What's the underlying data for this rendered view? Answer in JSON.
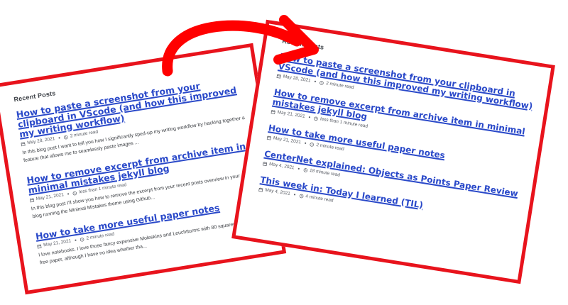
{
  "left_panel": {
    "heading": "Recent Posts",
    "posts": [
      {
        "title": "How to paste a screenshot from your clipboard in VScode (and how this improved my writing workflow)",
        "date": "May 28, 2021",
        "read_time": "2 minute read",
        "excerpt": "In this blog post I want to tell you how I significantly sped-up my writing workflow by hacking together a feature that allows me to seamlessly paste images ..."
      },
      {
        "title": "How to remove excerpt from archive item in minimal mistakes jekyll blog",
        "date": "May 21, 2021",
        "read_time": "less than 1 minute read",
        "excerpt": "In this blog post I'll show you how to remove the excerpt from your recent posts overview in your Jekyll blog running the Minimal Mistakes theme using Github..."
      },
      {
        "title": "How to take more useful paper notes",
        "date": "May 21, 2021",
        "read_time": "2 minute read",
        "excerpt": "I love notebooks. I love those fancy expensive Moleskins and Leuchtturms with 80 squared meter acid-free paper, although I have no idea whether tha..."
      }
    ]
  },
  "right_panel": {
    "heading": "Recent Posts",
    "posts": [
      {
        "title": "How to paste a screenshot from your clipboard in VScode (and how this improved my writing workflow)",
        "date": "May 28, 2021",
        "read_time": "2 minute read"
      },
      {
        "title": "How to remove excerpt from archive item in minimal mistakes jekyll blog",
        "date": "May 21, 2021",
        "read_time": "less than 1 minute read"
      },
      {
        "title": "How to take more useful paper notes",
        "date": "May 21, 2021",
        "read_time": "2 minute read"
      },
      {
        "title": "CenterNet explained: Objects as Points Paper Review",
        "date": "May 4, 2021",
        "read_time": "18 minute read"
      },
      {
        "title": "This week in: Today I learned (TIL)",
        "date": "May 4, 2021",
        "read_time": "4 minute read"
      }
    ]
  },
  "colors": {
    "frame": "#e8131c",
    "arrow": "#ff0000",
    "link": "#2a49c9",
    "meta": "#5a5e66"
  },
  "icons": {
    "date": "calendar-icon",
    "read_time": "clock-icon",
    "transition": "curved-arrow-icon"
  }
}
